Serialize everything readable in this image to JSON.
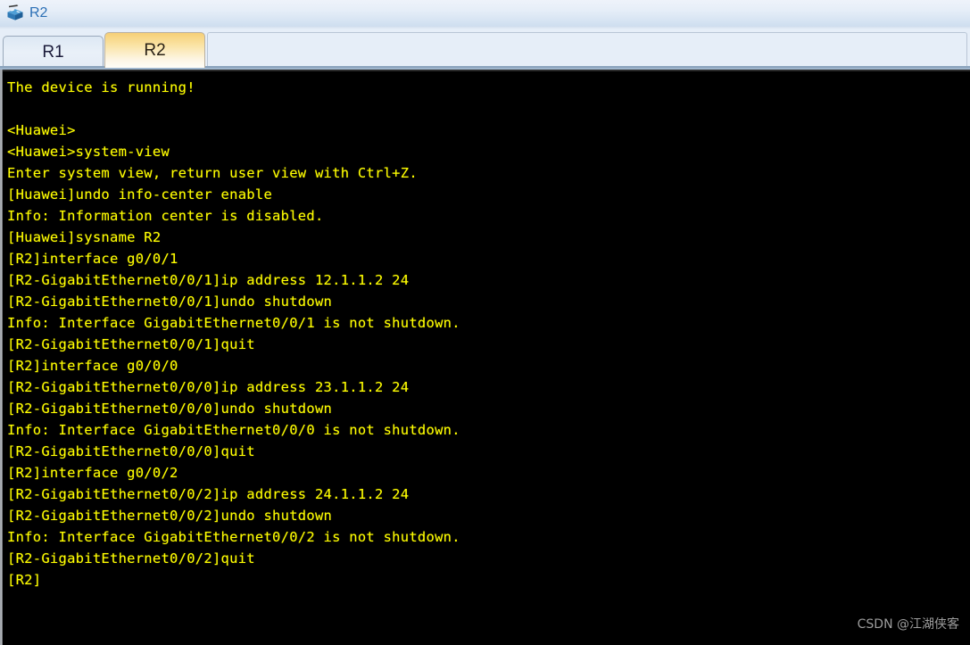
{
  "window": {
    "title": "R2",
    "icon": "router-icon"
  },
  "tabs": [
    {
      "label": "R1",
      "active": false
    },
    {
      "label": "R2",
      "active": true
    }
  ],
  "terminal": {
    "foreground_color": "#ffff00",
    "background_color": "#000000",
    "lines": [
      "The device is running!",
      "",
      "<Huawei>",
      "<Huawei>system-view",
      "Enter system view, return user view with Ctrl+Z.",
      "[Huawei]undo info-center enable",
      "Info: Information center is disabled.",
      "[Huawei]sysname R2",
      "[R2]interface g0/0/1",
      "[R2-GigabitEthernet0/0/1]ip address 12.1.1.2 24",
      "[R2-GigabitEthernet0/0/1]undo shutdown",
      "Info: Interface GigabitEthernet0/0/1 is not shutdown.",
      "[R2-GigabitEthernet0/0/1]quit",
      "[R2]interface g0/0/0",
      "[R2-GigabitEthernet0/0/0]ip address 23.1.1.2 24",
      "[R2-GigabitEthernet0/0/0]undo shutdown",
      "Info: Interface GigabitEthernet0/0/0 is not shutdown.",
      "[R2-GigabitEthernet0/0/0]quit",
      "[R2]interface g0/0/2",
      "[R2-GigabitEthernet0/0/2]ip address 24.1.1.2 24",
      "[R2-GigabitEthernet0/0/2]undo shutdown",
      "Info: Interface GigabitEthernet0/0/2 is not shutdown.",
      "[R2-GigabitEthernet0/0/2]quit",
      "[R2]"
    ]
  },
  "watermark": {
    "text": "CSDN @江湖侠客"
  }
}
